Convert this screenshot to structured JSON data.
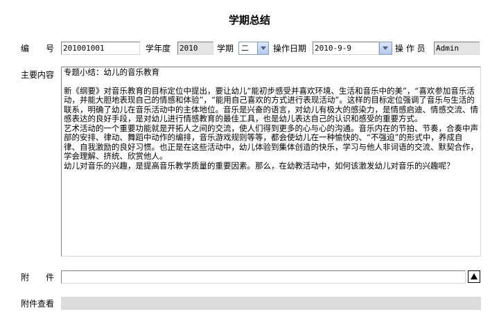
{
  "page_title": "学期总结",
  "form": {
    "number_label": "编　　号",
    "number_value": "201001001",
    "school_year_label": "学年度",
    "school_year_value": "2010",
    "semester_label": "学期",
    "semester_value": "二",
    "op_date_label": "操作日期",
    "op_date_value": "2010-9-9",
    "operator_label": "操 作 员",
    "operator_value": "Admin",
    "content_label": "主要内容",
    "content_heading": "专题小结：幼儿的音乐教育",
    "content_paragraphs": [
      "新《纲要》对音乐教育的目标定位中提出，要让幼儿“能初步感受并喜欢环境、生活和音乐中的美”，“喜欢参加音乐活动，并能大胆地表现自己的情感和体验”，“能用自己喜欢的方式进行表现活动”。这样的目标定位强调了音乐与生活的联系，明确了幼儿在音乐活动中的主体地位。音乐是兴奋的语言，对幼儿有极大的感染力，是情感启迪、情感交流、情感表达的良好手段，是对幼儿进行情感教育的最佳工具，也是幼儿表达自己的认识和感受的重要方式。",
      "艺术活动的一个重要功能就是开拓人之间的交流，使人们得到更多的心与心的沟通。音乐内在的节拍、节奏，合奏中声部的安排、律动、舞蹈中动作的编排，音乐游戏规则等等，都会使幼儿在一种愉快的、“不强迫”的形式中，养成自律、自我激励的良好习惯。也正是在这些活动中，幼儿体验到集体创造的快乐，学习与他人非词语的交流、默契合作，学会理解、挤统、欣赏他人。",
      "幼儿对音乐的兴趣，是提高音乐教学质量的重要因素。那么，在幼教活动中，如何该激发幼儿对音乐的兴趣呢？"
    ],
    "attachment_label": "附　　件",
    "attachment_value": "",
    "attachment_view_label": "附件查看",
    "attachment_view_value": ""
  }
}
